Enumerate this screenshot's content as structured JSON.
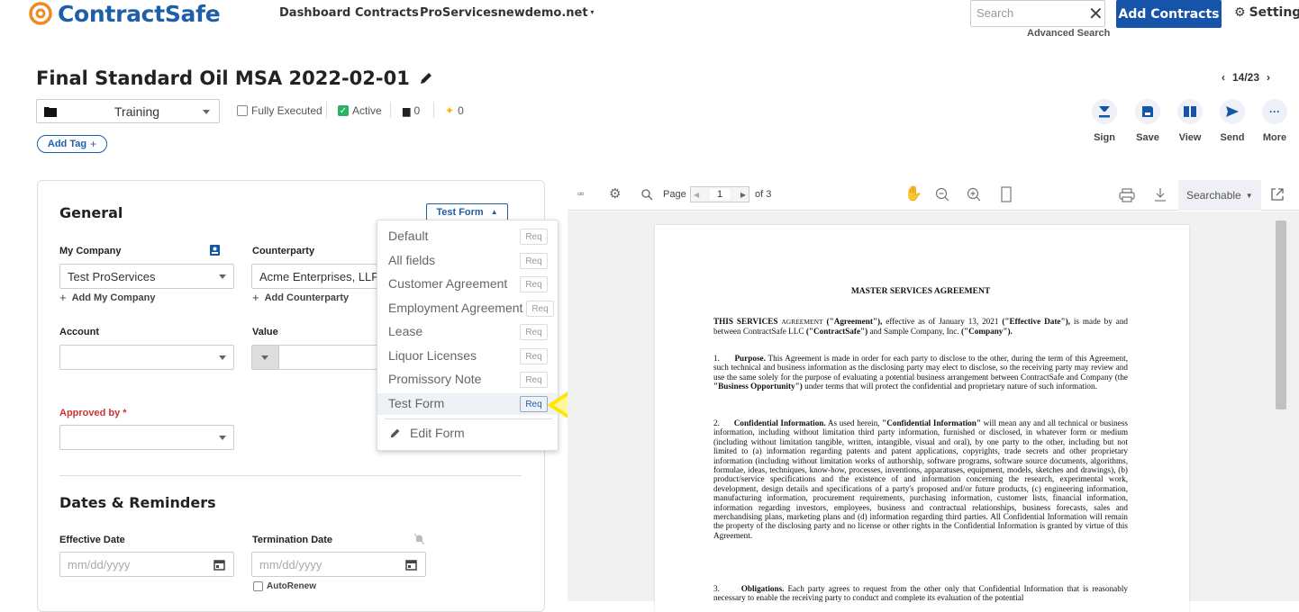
{
  "topbar": {
    "brand": "ContractSafe",
    "nav": [
      "Dashboard",
      "Contracts",
      "ProServicesnewdemo.net"
    ],
    "search_placeholder": "Search",
    "advanced_search": "Advanced Search",
    "add_contracts": "Add Contracts",
    "settings": "Settings"
  },
  "header": {
    "title": "Final Standard Oil MSA 2022-02-01",
    "pager": "14/23",
    "folder": "Training",
    "fully_executed": "Fully Executed",
    "active": "Active",
    "docs_count": "0",
    "star_count": "0",
    "add_tag": "Add Tag"
  },
  "actions": [
    {
      "label": "Sign"
    },
    {
      "label": "Save"
    },
    {
      "label": "View"
    },
    {
      "label": "Send"
    },
    {
      "label": "More"
    }
  ],
  "form": {
    "section_general": "General",
    "test_form": "Test Form",
    "my_company_label": "My Company",
    "my_company_value": "Test ProServices",
    "add_my_company": "Add My Company",
    "counterparty_label": "Counterparty",
    "counterparty_value": "Acme Enterprises, LLP",
    "add_counterparty": "Add Counterparty",
    "account_label": "Account",
    "value_label": "Value",
    "approved_by_label": "Approved by *",
    "section_dates": "Dates & Reminders",
    "effective_label": "Effective Date",
    "effective_ph": "mm/dd/yyyy",
    "termination_label": "Termination Date",
    "termination_ph": "mm/dd/yyyy",
    "autorenew": "AutoRenew"
  },
  "dropdown": {
    "items": [
      "Default",
      "All fields",
      "Customer Agreement",
      "Employment Agreement",
      "Lease",
      "Liquor Licenses",
      "Promissory Note",
      "Test Form"
    ],
    "req": "Req",
    "edit": "Edit Form"
  },
  "pdf": {
    "page_label": "Page",
    "page": "1",
    "of": "of 3",
    "searchable": "Searchable",
    "doc_title": "MASTER SERVICES AGREEMENT",
    "p0a": "THIS SERVICES ",
    "p0b": "AGREEMENT",
    "p0c": " (\"Agreement\"),",
    "p0d": " effective as of January 13, 2021 ",
    "p0e": "(\"Effective Date\"),",
    "p0f": " is made by and between ContractSafe LLC ",
    "p0g": "(\"ContractSafe\")",
    "p0h": " and Sample Company, Inc. ",
    "p0i": "(\"Company\").",
    "p1n": "1.",
    "p1h": "Purpose.",
    "p1t": " This Agreement is made in order for each party to disclose to the other, during the term of this Agreement, such technical and business information as the disclosing party may elect to disclose, so the receiving party may review and use the same solely for the purpose of evaluating a potential business arrangement between ContractSafe and Company (the ",
    "p1b": "\"Business Opportunity\")",
    "p1e": " under terms that will protect the confidential and proprietary nature of such information.",
    "p2n": "2.",
    "p2h": "Confidential Information.",
    "p2a": " As used herein, ",
    "p2b": "\"Confidential Information\"",
    "p2t": " will mean any and all technical or business information, including without limitation third party information, furnished or disclosed, in whatever form or medium (including without limitation tangible, written, intangible, visual and oral), by one party to the other, including but not limited to (a) information regarding patents and patent applications, copyrights, trade secrets and other proprietary information (including without limitation works of authorship, software programs, software source documents, algorithms, formulae, ideas, techniques, know-how, processes, inventions, apparatuses, equipment, models, sketches and drawings), (b) product/service specifications and the existence of and information concerning the research, experimental work, development, design details and specifications of a party's proposed and/or future products, (c) engineering information, manufacturing information, procurement requirements, purchasing information, customer lists, financial information, information regarding investors, employees, business and contractual relationships, business forecasts, sales and merchandising plans, marketing plans and (d) information regarding third parties. All Confidential Information will remain the property of the disclosing party and no license or other rights in the Confidential Information is granted by virtue of this Agreement.",
    "p3n": "3.",
    "p3h": "Obligations.",
    "p3t": " Each party agrees to request from the other only that Confidential Information that is reasonably necessary to enable the receiving party to conduct and complete its evaluation of the potential"
  },
  "colors": {
    "brand": "#1d5fa8",
    "button": "#1554a8",
    "arrow": "#ffe600"
  }
}
